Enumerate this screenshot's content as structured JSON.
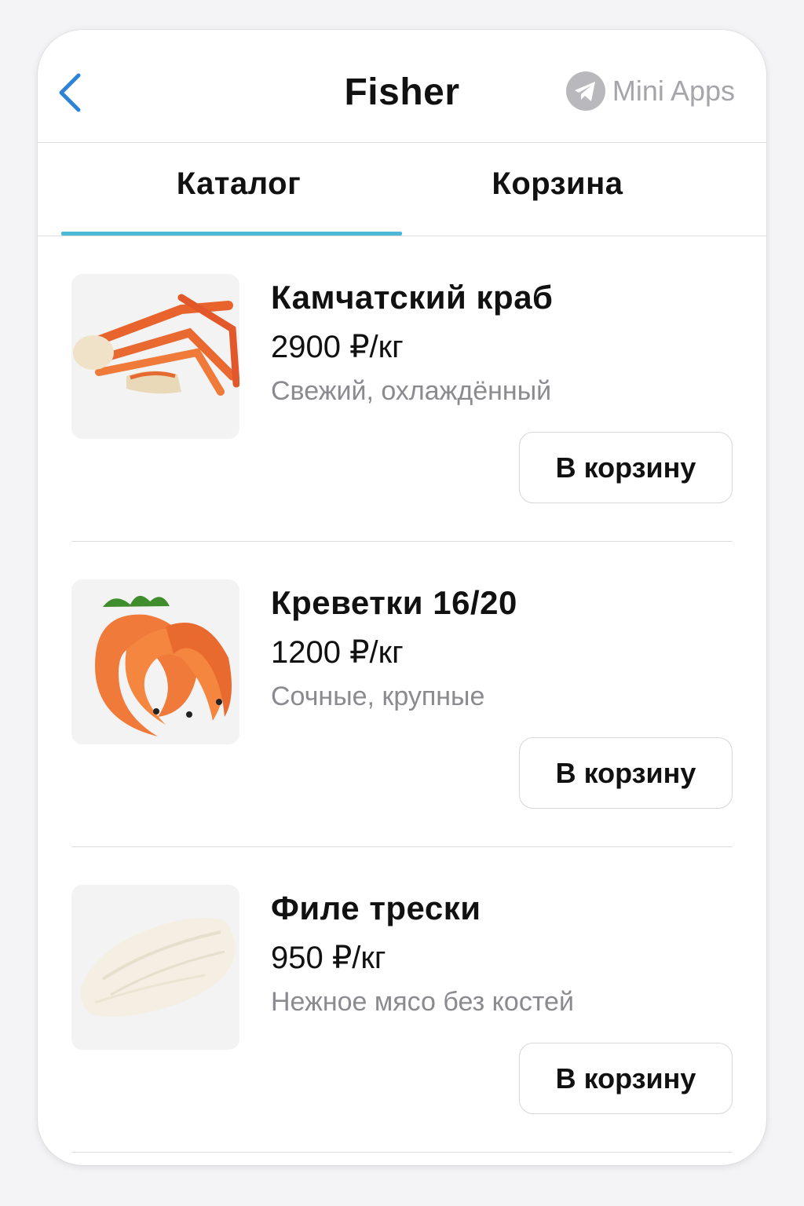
{
  "header": {
    "title": "Fisher",
    "back_icon": "chevron-left-icon",
    "mini_apps_label": "Mini Apps",
    "mini_apps_icon": "telegram-icon"
  },
  "tabs": [
    {
      "label": "Каталог",
      "active": true
    },
    {
      "label": "Корзина",
      "active": false
    }
  ],
  "colors": {
    "accent": "#4db8d6",
    "back_icon": "#2f83d6",
    "muted_text": "#8a8a8f"
  },
  "products": [
    {
      "name": "Камчатский краб",
      "price": "2900 ₽/кг",
      "description": "Свежий, охлаждённый",
      "button_label": "В корзину",
      "image_icon": "king-crab-image"
    },
    {
      "name": "Креветки 16/20",
      "price": "1200 ₽/кг",
      "description": "Сочные, крупные",
      "button_label": "В корзину",
      "image_icon": "shrimp-image"
    },
    {
      "name": "Филе трески",
      "price": "950 ₽/кг",
      "description": "Нежное мясо без костей",
      "button_label": "В корзину",
      "image_icon": "cod-fillet-image"
    }
  ]
}
